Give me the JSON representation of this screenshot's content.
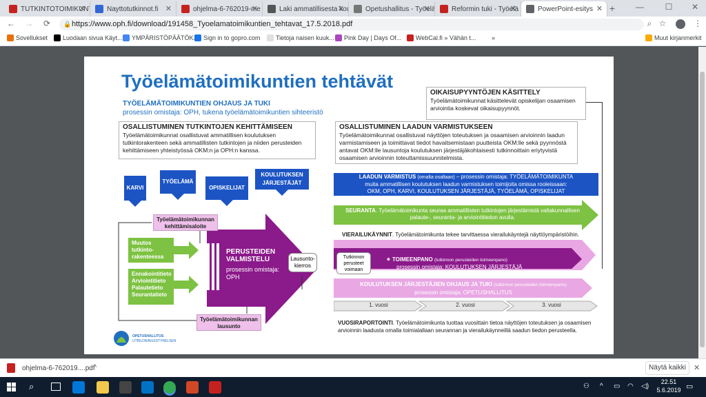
{
  "tabs": [
    {
      "label": "TUTKINTOTOIMIKUNTA",
      "color": "#c5221f"
    },
    {
      "label": "Nayttotutkinnot.fi",
      "color": "#3367d6"
    },
    {
      "label": "ohjelma-6-762019-me",
      "color": "#c5221f"
    },
    {
      "label": "Laki ammatillisesta kou",
      "color": "#555"
    },
    {
      "label": "Opetushallitus - Työelä",
      "color": "#777"
    },
    {
      "label": "Reformin tuki - Työelä",
      "color": "#c5221f"
    },
    {
      "label": "PowerPoint-esitys",
      "color": "#5f6368"
    }
  ],
  "new_tab": "+",
  "window_controls": {
    "minimize": "—",
    "maximize": "☐",
    "close": "✕"
  },
  "nav": {
    "back": "←",
    "forward": "→",
    "reload": "C"
  },
  "url": "https://www.oph.fi/download/191458_Tyoelamatoimikuntien_tehtavat_17.5.2018.pdf",
  "bookmarks": [
    {
      "label": "Sovellukset",
      "color": "#e8710a"
    },
    {
      "label": "Luodaan sivua Käyt...",
      "color": "#000"
    },
    {
      "label": "YMPÄRISTÖPÄÄTÖK...",
      "color": "#4285f4"
    },
    {
      "label": "Sign in to gopro.com",
      "color": "#1a73e8"
    },
    {
      "label": "Tietoja naisen kuuk...",
      "color": "#e0e0e0"
    },
    {
      "label": "Pink Day | Days Of...",
      "color": "#ab47bc"
    },
    {
      "label": "WebCal.fi » Vähän t...",
      "color": "#c5221f"
    },
    {
      "label": "»",
      "color": "transparent"
    },
    {
      "label": "Muut kirjanmerkit",
      "color": "#f9ab00"
    }
  ],
  "slide": {
    "title": "Työelämätoimikuntien tehtävät",
    "ohjaus_title": "TYÖELÄMÄTOIMIKUNTIEN OHJAUS JA TUKI",
    "ohjaus_sub": "prosessin omistaja: OPH, tukena työelämätoimikuntien sihteeristö",
    "oikaisu_title": "OIKAISUPYYNTÖJEN KÄSITTELY",
    "oikaisu_text": "Työelämätoimikunnat käsittelevät opiskelijan osaamisen arviointia koskevat oikaisupyynnöt.",
    "kehitt_title": "OSALLISTUMINEN TUTKINTOJEN KEHITTÄMISEEN",
    "kehitt_text": "Työelämätoimikunnat osallistuvat ammatillisen koulutuksen tutkintorakenteen sekä ammatillisten tutkintojen ja niiden perusteiden kehittämiseen yhteistyössä OKM:n ja OPH:n kanssa.",
    "laatu_title": "OSALLISTUMINEN LAADUN VARMISTUKSEEN",
    "laatu_text": "Työelämätoimikunnat osallistuvat näyttöjen toteutuksen ja osaamisen arvioinnin laadun varmistamiseen ja toimittavat tiedot havaitsemistaan puutteista OKM:lle sekä pyynnöstä antavat OKM:lle lausuntoja koulutuksen järjestäjäkohtaisesti tutkinnoittain eriytyvistä osaamisen arvioinnin toteuttamissuunnitelmista.",
    "sources": [
      "KARVI",
      "TYÖELÄMÄ",
      "OPISKELIJAT",
      "KOULUTUKSEN JÄRJESTÄJÄT"
    ],
    "kehitt_aloite": "Työelämätoimikunnan kehittämisaloite",
    "muutos": "Muutos tutkinto-rakenteessa",
    "ennakko": "Ennakointitieto Arviointitieto Palautetieto Seurantatieto",
    "valmistelu_title": "PERUSTEIDEN VALMISTELU",
    "valmistelu_sub": "prosessin omistaja: OPH",
    "lausuntokierros": "Lausunto-kierros",
    "lausunto": "Työelämätoimikunnan lausunto",
    "laatuv_title": "LAADUN VARMISTUS",
    "laatuv_paren": "(omalta osaltaan)",
    "laatuv_rest": "– prosessin omistaja: TYÖELÄMÄTOIMIKUNTA",
    "laatuv_line2": "muita ammatillisen koulutuksen laadun varmistuksen toimijoita omissa rooleissaan:",
    "laatuv_line3": "OKM, OPH, KARVI, KOULUTUKSEN JÄRJESTÄJÄ, TYÖELÄMÄ, OPISKELIJAT",
    "seuranta_title": "SEURANTA",
    "seuranta_text": ". Työelämätoimikunta seuraa ammatillisten tutkintojen järjestämistä valtakunnallisen palaute-, seuranta- ja arviointitiedon avulla.",
    "vierailu_title": "VIERAILUKÄYNNIT",
    "vierailu_text": ". Työelämätoimikunta tekee tarvittaessa vierailukäyntejä näyttöympäristöihin.",
    "perusteet_voimaan": "Tutkinnon perusteet voimaan",
    "toimeenpano_title": "TOIMEENPANO",
    "toimeenpano_paren": "(tutkinnon perusteiden toimeenpano)",
    "toimeenpano_sub": "prosessin omistaja: KOULUTUKSEN JÄRJESTÄJÄ",
    "ohjaus2_title": "KOULUTUKSEN JÄRJESTÄJIEN OHJAUS JA TUKI",
    "ohjaus2_paren": "(tutkinnon perusteiden toimeenpano)",
    "ohjaus2_sub": "prosessin omistaja: OPETUSHALLITUS",
    "years": [
      "1. vuosi",
      "2. vuosi",
      "3. vuosi"
    ],
    "vuosiraportointi_title": "VUOSIRAPORTOINTI",
    "vuosiraportointi_text": ". Työelämätoimikunta tuottaa vuosittain tietoa näyttöjen toteutuksen ja osaamisen arvioinnin laadusta omalla toimialallaan seurannan ja vierailukäynneillä saadun tiedon perusteella.",
    "logo_line1": "OPETUSHALLITUS",
    "logo_line2": "UTBILDNINGSSTYRELSEN"
  },
  "download": {
    "filename": "ohjelma-6-762019....pdf",
    "show_all": "Näytä kaikki"
  },
  "clock": {
    "time": "22.51",
    "date": "5.6.2019"
  }
}
